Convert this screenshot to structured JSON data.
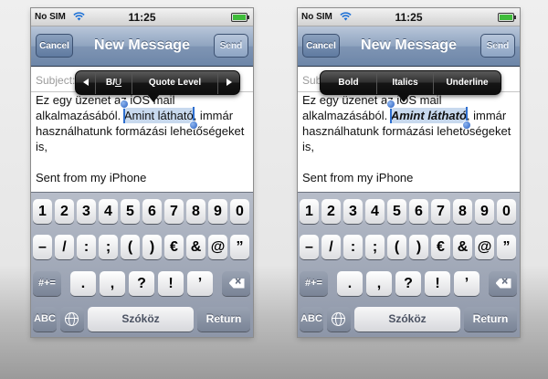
{
  "status": {
    "carrier": "No SIM",
    "time": "11:25"
  },
  "nav": {
    "title": "New Message",
    "cancel": "Cancel",
    "send": "Send"
  },
  "subject": {
    "label": "Subject:"
  },
  "body": {
    "line1_before": "Ez egy üzenet az iOS mail",
    "line2_before": "alkalmazásából. ",
    "selected": "Amint látható",
    "line2_after": ", immár",
    "line3": "használhatunk formázási lehetőségeket is,",
    "signature": "Sent from my iPhone"
  },
  "popup_left": {
    "biu": "BIU",
    "b": "B",
    "i": "I",
    "u": "U",
    "quote": "Quote Level"
  },
  "popup_right": {
    "bold": "Bold",
    "italics": "Italics",
    "underline": "Underline"
  },
  "keyboard": {
    "row1": [
      "1",
      "2",
      "3",
      "4",
      "5",
      "6",
      "7",
      "8",
      "9",
      "0"
    ],
    "row2": [
      "–",
      "/",
      ":",
      ";",
      "(",
      ")",
      "€",
      "&",
      "@",
      "”"
    ],
    "row3_left": "#+=",
    "row3": [
      ".",
      ",",
      "?",
      "!",
      "’"
    ],
    "abc": "ABC",
    "space": "Szóköz",
    "return": "Return"
  },
  "icons": [
    "wifi-icon",
    "battery-icon",
    "globe-icon",
    "delete-icon",
    "arrow-left-icon",
    "arrow-right-icon"
  ],
  "colors": {
    "nav_bar": "#7f95b4",
    "selection": "#c8d9ee",
    "handle": "#2f6fcf",
    "battery": "#3fbc3a"
  }
}
